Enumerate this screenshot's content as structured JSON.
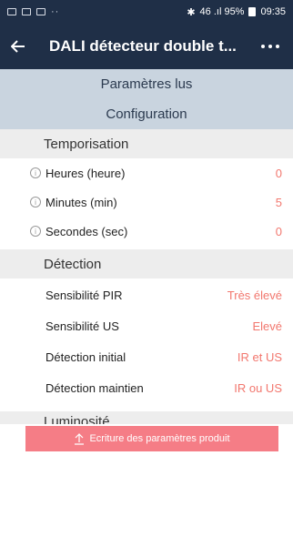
{
  "statusbar": {
    "right_text": "46 .ıl 95%",
    "time": "09:35"
  },
  "appbar": {
    "title": "DALI détecteur double t..."
  },
  "tabs": {
    "read_params": "Paramètres lus",
    "configuration": "Configuration"
  },
  "sections": {
    "temporisation": {
      "title": "Temporisation",
      "rows": [
        {
          "label": "Heures (heure)",
          "value": "0"
        },
        {
          "label": "Minutes (min)",
          "value": "5"
        },
        {
          "label": "Secondes (sec)",
          "value": "0"
        }
      ]
    },
    "detection": {
      "title": "Détection",
      "rows": [
        {
          "label": "Sensibilité PIR",
          "value": "Très élevé"
        },
        {
          "label": "Sensibilité US",
          "value": "Elevé"
        },
        {
          "label": "Détection initial",
          "value": "IR et US"
        },
        {
          "label": "Détection maintien",
          "value": "IR ou US"
        }
      ]
    },
    "luminosite": {
      "title": "Luminosité"
    }
  },
  "actions": {
    "write_label": "Ecriture des paramètres produit"
  },
  "colors": {
    "header_bg": "#1f2f47",
    "tab_bg": "#c9d4df",
    "section_bg": "#ededed",
    "value_red": "#f2776e",
    "button_pink": "#f57d86"
  }
}
